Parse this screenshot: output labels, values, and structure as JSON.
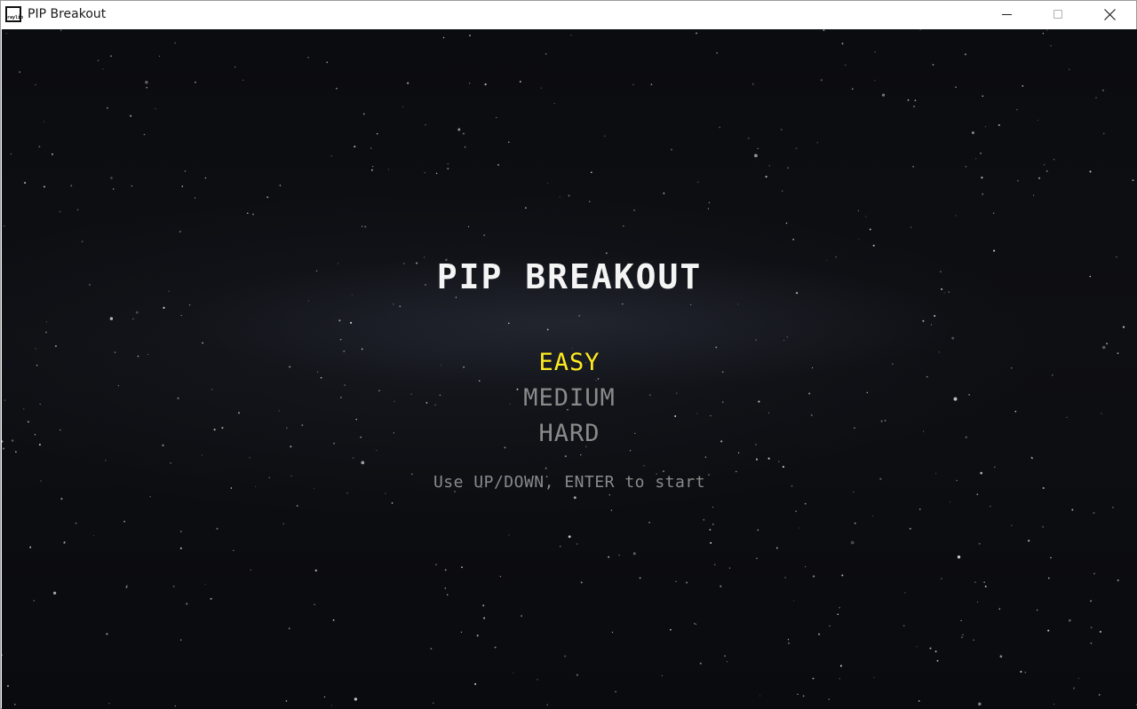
{
  "window": {
    "title": "PIP Breakout",
    "icon": "raylib-icon",
    "icon_text": "raylib",
    "controls": [
      "minimize-icon",
      "maximize-icon",
      "close-icon"
    ]
  },
  "game": {
    "title": "PIP BREAKOUT",
    "menu": {
      "options": [
        "EASY",
        "MEDIUM",
        "HARD"
      ],
      "selected": "EASY"
    },
    "hint": "Use UP/DOWN, ENTER to start"
  },
  "colors": {
    "background": "#0b0c10",
    "title": "#f4f4f4",
    "selected": "#ffea1f",
    "unselected": "#8a8a8a"
  }
}
